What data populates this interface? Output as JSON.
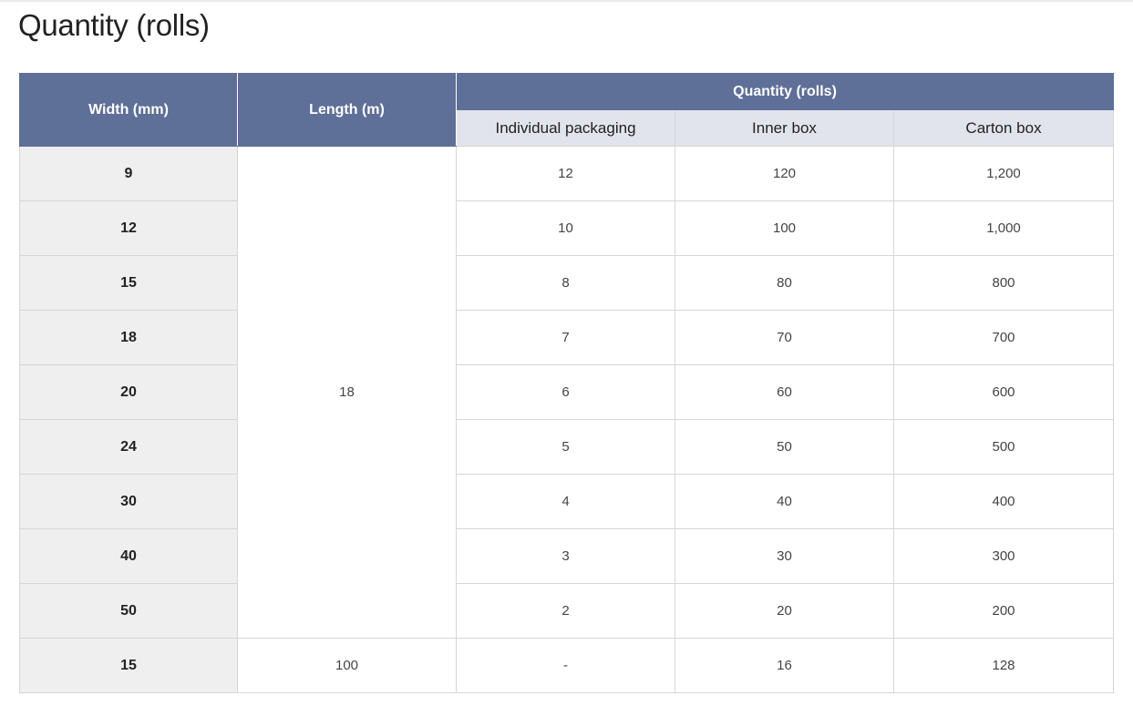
{
  "page": {
    "title": "Quantity (rolls)"
  },
  "table": {
    "headers": {
      "width": "Width (mm)",
      "length": "Length (m)",
      "quantity": "Quantity (rolls)",
      "individual": "Individual packaging",
      "inner": "Inner box",
      "carton": "Carton box"
    },
    "length_group_1": "18",
    "rows": [
      {
        "width": "9",
        "individual": "12",
        "inner": "120",
        "carton": "1,200"
      },
      {
        "width": "12",
        "individual": "10",
        "inner": "100",
        "carton": "1,000"
      },
      {
        "width": "15",
        "individual": "8",
        "inner": "80",
        "carton": "800"
      },
      {
        "width": "18",
        "individual": "7",
        "inner": "70",
        "carton": "700"
      },
      {
        "width": "20",
        "individual": "6",
        "inner": "60",
        "carton": "600"
      },
      {
        "width": "24",
        "individual": "5",
        "inner": "50",
        "carton": "500"
      },
      {
        "width": "30",
        "individual": "4",
        "inner": "40",
        "carton": "400"
      },
      {
        "width": "40",
        "individual": "3",
        "inner": "30",
        "carton": "300"
      },
      {
        "width": "50",
        "individual": "2",
        "inner": "20",
        "carton": "200"
      },
      {
        "width": "15",
        "length": "100",
        "individual": "-",
        "inner": "16",
        "carton": "128"
      }
    ]
  },
  "colors": {
    "header_dark": "#5e6f98",
    "header_light": "#e1e4ec",
    "first_column": "#efefef",
    "border": "#d6d6d6"
  }
}
